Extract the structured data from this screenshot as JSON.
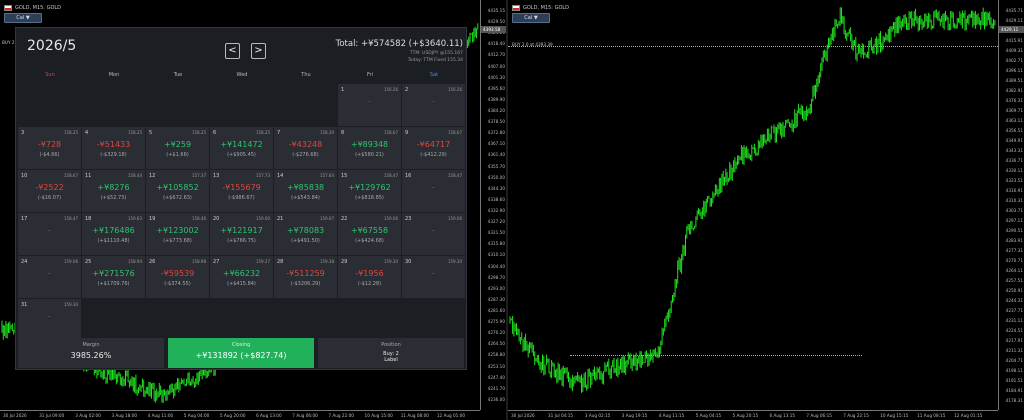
{
  "left_chart": {
    "title": "GOLD, M15: GOLD",
    "one_click": "Cal ▼",
    "price_tag": "4393.58",
    "price_labels": [
      "4435.15",
      "4429.50",
      "4424.20",
      "4418.40",
      "4412.70",
      "4407.00",
      "4401.30",
      "4395.60",
      "4389.90",
      "4384.20",
      "4378.50",
      "4372.80",
      "4367.10",
      "4361.40",
      "4355.70",
      "4350.00",
      "4344.30",
      "4338.60",
      "4332.90",
      "4327.20",
      "4321.50",
      "4315.80",
      "4310.10",
      "4304.40",
      "4298.70",
      "4293.00",
      "4287.30",
      "4281.60",
      "4275.90",
      "4270.20",
      "4264.50",
      "4258.80",
      "4253.10",
      "4247.40",
      "4241.70",
      "4236.00"
    ],
    "time_labels": [
      "30 Jul 2026",
      "31 Jul 09:00",
      "3 Aug 02:00",
      "3 Aug 18:00",
      "4 Aug 11:00",
      "5 Aug 04:00",
      "5 Aug 20:00",
      "6 Aug 13:00",
      "7 Aug 06:00",
      "7 Aug 22:00",
      "10 Aug 15:00",
      "11 Aug 08:00",
      "12 Aug 01:00"
    ],
    "position_label": "BUY 2"
  },
  "calendar": {
    "month": "2026/5",
    "prev": "<",
    "next": ">",
    "total": "Total: +¥574582 (+$3640.11)",
    "ttm_line": "TTM: USDJPY @155.167",
    "today_line": "Today: TTM Fixed 155.34",
    "weekdays": [
      "Sun",
      "Mon",
      "Tue",
      "Wed",
      "Thu",
      "Fri",
      "Sat"
    ],
    "days": [
      {
        "d": "1",
        "rate": "156.26",
        "yen": "",
        "usd": "",
        "sign": "none"
      },
      {
        "d": "2",
        "rate": "156.26",
        "yen": "",
        "usd": "",
        "sign": "none"
      },
      {
        "d": "3",
        "rate": "158.25",
        "yen": "-¥728",
        "usd": "(-$4.66)",
        "sign": "neg"
      },
      {
        "d": "4",
        "rate": "158.25",
        "yen": "-¥51433",
        "usd": "(-$329.18)",
        "sign": "neg"
      },
      {
        "d": "5",
        "rate": "158.25",
        "yen": "+¥259",
        "usd": "(+$1.66)",
        "sign": "pos"
      },
      {
        "d": "6",
        "rate": "158.25",
        "yen": "+¥141472",
        "usd": "(+$905.45)",
        "sign": "pos"
      },
      {
        "d": "7",
        "rate": "158.30",
        "yen": "-¥43248",
        "usd": "(-$276.68)",
        "sign": "neg"
      },
      {
        "d": "8",
        "rate": "158.67",
        "yen": "+¥89348",
        "usd": "(+$580.21)",
        "sign": "pos"
      },
      {
        "d": "9",
        "rate": "158.67",
        "yen": "-¥64717",
        "usd": "(-$412.29)",
        "sign": "neg"
      },
      {
        "d": "10",
        "rate": "158.67",
        "yen": "-¥2522",
        "usd": "(-$16.07)",
        "sign": "neg"
      },
      {
        "d": "11",
        "rate": "158.44",
        "yen": "+¥8276",
        "usd": "(+$52.73)",
        "sign": "pos"
      },
      {
        "d": "12",
        "rate": "157.37",
        "yen": "+¥105852",
        "usd": "(+$672.63)",
        "sign": "pos"
      },
      {
        "d": "13",
        "rate": "157.73",
        "yen": "-¥155679",
        "usd": "(-$986.67)",
        "sign": "neg"
      },
      {
        "d": "14",
        "rate": "157.64",
        "yen": "+¥85838",
        "usd": "(+$543.84)",
        "sign": "pos"
      },
      {
        "d": "15",
        "rate": "158.47",
        "yen": "+¥129762",
        "usd": "(+$818.85)",
        "sign": "pos"
      },
      {
        "d": "16",
        "rate": "158.47",
        "yen": "",
        "usd": "",
        "sign": "none"
      },
      {
        "d": "17",
        "rate": "158.47",
        "yen": "",
        "usd": "",
        "sign": "none"
      },
      {
        "d": "18",
        "rate": "159.63",
        "yen": "+¥176486",
        "usd": "(+$1110.48)",
        "sign": "pos"
      },
      {
        "d": "19",
        "rate": "158.46",
        "yen": "+¥123002",
        "usd": "(+$773.68)",
        "sign": "pos"
      },
      {
        "d": "20",
        "rate": "159.00",
        "yen": "+¥121917",
        "usd": "(+$766.75)",
        "sign": "pos"
      },
      {
        "d": "21",
        "rate": "159.07",
        "yen": "+¥78083",
        "usd": "(+$491.50)",
        "sign": "pos"
      },
      {
        "d": "22",
        "rate": "159.06",
        "yen": "+¥67558",
        "usd": "(+$424.68)",
        "sign": "pos"
      },
      {
        "d": "23",
        "rate": "159.06",
        "yen": "",
        "usd": "",
        "sign": "none"
      },
      {
        "d": "24",
        "rate": "159.06",
        "yen": "",
        "usd": "",
        "sign": "none"
      },
      {
        "d": "25",
        "rate": "158.94",
        "yen": "+¥271576",
        "usd": "(+$1709.76)",
        "sign": "pos"
      },
      {
        "d": "26",
        "rate": "158.98",
        "yen": "-¥59539",
        "usd": "(-$374.55)",
        "sign": "neg"
      },
      {
        "d": "27",
        "rate": "159.27",
        "yen": "+¥66232",
        "usd": "(+$415.84)",
        "sign": "pos"
      },
      {
        "d": "28",
        "rate": "159.38",
        "yen": "-¥511259",
        "usd": "(-$3206.29)",
        "sign": "neg"
      },
      {
        "d": "29",
        "rate": "159.30",
        "yen": "-¥1956",
        "usd": "(-$12.28)",
        "sign": "neg"
      },
      {
        "d": "30",
        "rate": "159.30",
        "yen": "",
        "usd": "",
        "sign": "none"
      },
      {
        "d": "31",
        "rate": "159.30",
        "yen": "",
        "usd": "",
        "sign": "none"
      }
    ],
    "stats": {
      "margin_label": "Margin",
      "margin_value": "3985.26%",
      "closing_label": "Closing",
      "closing_value": "+¥131892 (+$827.74)",
      "position_label": "Position",
      "position_value": "Buy: 2",
      "position_sub": "Label"
    }
  },
  "right_chart": {
    "title": "GOLD, M15: GOLD",
    "one_click": "Cal ▼",
    "price_tag": "4429.11",
    "position_label": "BUY 2.0 at 4393.39",
    "price_labels": [
      "4435.71",
      "4429.11",
      "4422.51",
      "4415.91",
      "4409.31",
      "4402.71",
      "4396.11",
      "4389.51",
      "4382.91",
      "4376.31",
      "4369.71",
      "4363.11",
      "4356.51",
      "4349.91",
      "4343.31",
      "4336.71",
      "4330.11",
      "4323.51",
      "4316.91",
      "4310.31",
      "4303.71",
      "4297.11",
      "4290.51",
      "4283.91",
      "4277.31",
      "4270.71",
      "4264.11",
      "4257.51",
      "4250.91",
      "4244.31",
      "4237.71",
      "4231.11",
      "4224.51",
      "4217.91",
      "4211.31",
      "4204.71",
      "4198.11",
      "4191.51",
      "4184.91",
      "4178.31"
    ],
    "time_labels": [
      "30 Jul 2026",
      "31 Jul 04:15",
      "3 Aug 02:15",
      "3 Aug 19:15",
      "4 Aug 11:15",
      "5 Aug 04:15",
      "5 Aug 20:15",
      "6 Aug 13:15",
      "7 Aug 06:15",
      "7 Aug 22:15",
      "10 Aug 15:15",
      "11 Aug 08:15",
      "12 Aug 01:15"
    ]
  },
  "colors": {
    "candle": "#22e022",
    "positive": "#2ec46e",
    "negative": "#e0463c",
    "closing_bg": "#20b15a"
  }
}
